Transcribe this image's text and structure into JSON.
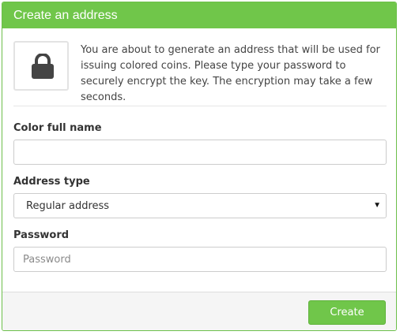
{
  "dialog": {
    "title": "Create an address",
    "intro_text": "You are about to generate an address that will be used for issuing colored coins. Please type your password to securely encrypt the key. The encryption may take a few seconds.",
    "intro_icon": "lock-icon"
  },
  "form": {
    "color_name": {
      "label": "Color full name",
      "value": "",
      "placeholder": ""
    },
    "address_type": {
      "label": "Address type",
      "selected": "Regular address"
    },
    "password": {
      "label": "Password",
      "value": "",
      "placeholder": "Password"
    }
  },
  "footer": {
    "create_label": "Create"
  },
  "colors": {
    "accent": "#70c64a",
    "border": "#cccccc",
    "text": "#333333"
  }
}
